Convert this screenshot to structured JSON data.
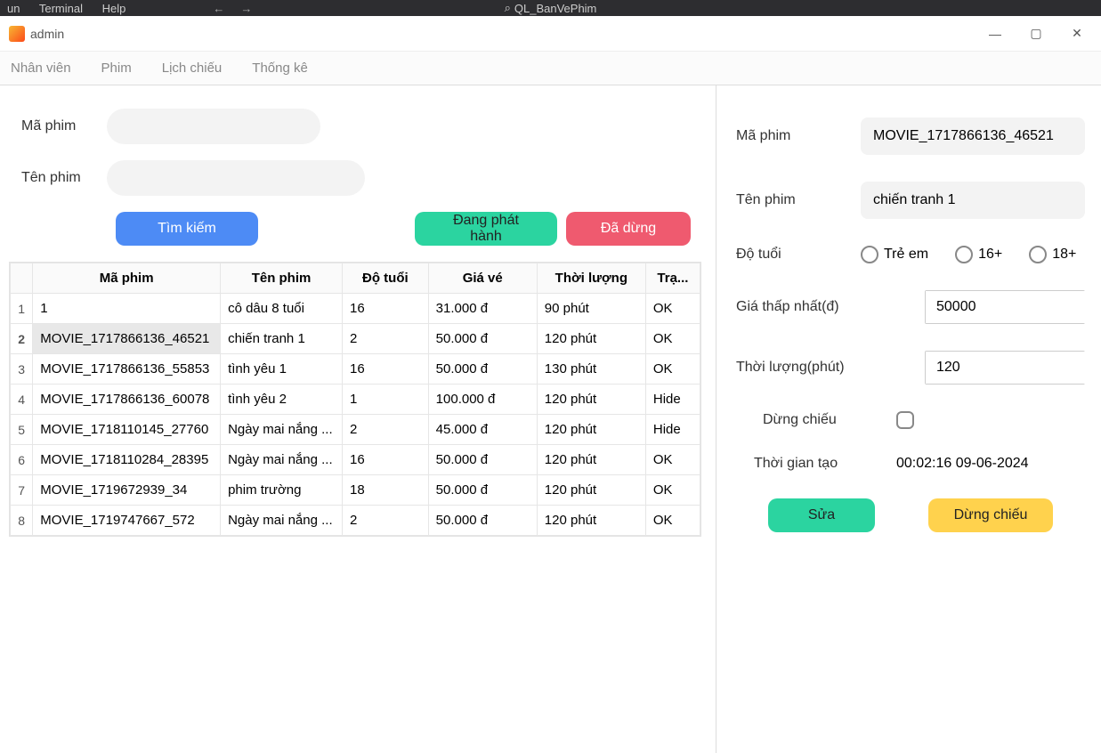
{
  "ide": {
    "menu_items": [
      "un",
      "Terminal",
      "Help"
    ],
    "project": "QL_BanVePhim",
    "nav_back": "←",
    "nav_fwd": "→",
    "search_icon": "⌕"
  },
  "window": {
    "title": "admin",
    "min": "—",
    "max": "▢",
    "close": "✕"
  },
  "menu": {
    "items": [
      "Nhân viên",
      "Phim",
      "Lịch chiếu",
      "Thống kê"
    ]
  },
  "filters": {
    "label_id": "Mã phim",
    "label_name": "Tên phim",
    "value_id": "",
    "value_name": "",
    "btn_search": "Tìm kiếm",
    "btn_playing": "Đang phát hành",
    "btn_stopped": "Đã dừng"
  },
  "table": {
    "headers": [
      "Mã phim",
      "Tên phim",
      "Độ tuổi",
      "Giá vé",
      "Thời lượng",
      "Trạ..."
    ],
    "rows": [
      {
        "n": "1",
        "id": "1",
        "name": "cô dâu 8 tuổi",
        "age": "16",
        "price": "31.000 đ",
        "dur": "90 phút",
        "st": "OK"
      },
      {
        "n": "2",
        "id": "MOVIE_1717866136_46521",
        "name": "chiến tranh 1",
        "age": "2",
        "price": "50.000 đ",
        "dur": "120 phút",
        "st": "OK"
      },
      {
        "n": "3",
        "id": "MOVIE_1717866136_55853",
        "name": "tình yêu 1",
        "age": "16",
        "price": "50.000 đ",
        "dur": "130 phút",
        "st": "OK"
      },
      {
        "n": "4",
        "id": "MOVIE_1717866136_60078",
        "name": "tình yêu 2",
        "age": "1",
        "price": "100.000 đ",
        "dur": "120 phút",
        "st": "Hide"
      },
      {
        "n": "5",
        "id": "MOVIE_1718110145_27760",
        "name": "Ngày mai nắng ...",
        "age": "2",
        "price": "45.000 đ",
        "dur": "120 phút",
        "st": "Hide"
      },
      {
        "n": "6",
        "id": "MOVIE_1718110284_28395",
        "name": "Ngày mai nắng ...",
        "age": "16",
        "price": "50.000 đ",
        "dur": "120 phút",
        "st": "OK"
      },
      {
        "n": "7",
        "id": "MOVIE_1719672939_34",
        "name": "phim trường",
        "age": "18",
        "price": "50.000 đ",
        "dur": "120 phút",
        "st": "OK"
      },
      {
        "n": "8",
        "id": "MOVIE_1719747667_572",
        "name": "Ngày mai nắng ...",
        "age": "2",
        "price": "50.000 đ",
        "dur": "120 phút",
        "st": "OK"
      }
    ],
    "selected_index": 1
  },
  "detail": {
    "label_id": "Mã phim",
    "value_id": "MOVIE_1717866136_46521",
    "label_name": "Tên phim",
    "value_name": "chiến tranh 1",
    "label_age": "Độ tuổi",
    "age_options": [
      "Trẻ em",
      "16+",
      "18+"
    ],
    "label_price": "Giá thấp nhất(đ)",
    "value_price": "50000",
    "label_duration": "Thời lượng(phút)",
    "value_duration": "120",
    "label_paused": "Dừng chiếu",
    "label_created": "Thời gian tạo",
    "value_created": "00:02:16 09-06-2024",
    "btn_edit": "Sửa",
    "btn_stop": "Dừng chiếu"
  }
}
